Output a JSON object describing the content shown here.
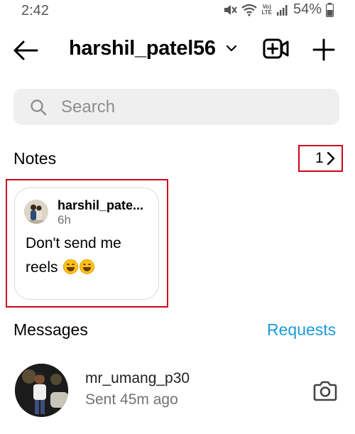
{
  "status_bar": {
    "time": "2:42",
    "battery": "54%",
    "network_label_top": "Vo)",
    "network_label_bottom": "LTE"
  },
  "header": {
    "username": "harshil_patel56"
  },
  "search": {
    "placeholder": "Search"
  },
  "notes": {
    "title": "Notes",
    "count": "1",
    "items": [
      {
        "username": "harshil_pate...",
        "time": "6h",
        "text": "Don't send me reels"
      }
    ]
  },
  "messages": {
    "title": "Messages",
    "requests_label": "Requests",
    "items": [
      {
        "username": "mr_umang_p30",
        "subtitle": "Sent 45m ago"
      }
    ]
  },
  "colors": {
    "accent_blue": "#1c9bd8",
    "highlight_red": "#d0021b",
    "search_bg": "#efefef"
  }
}
